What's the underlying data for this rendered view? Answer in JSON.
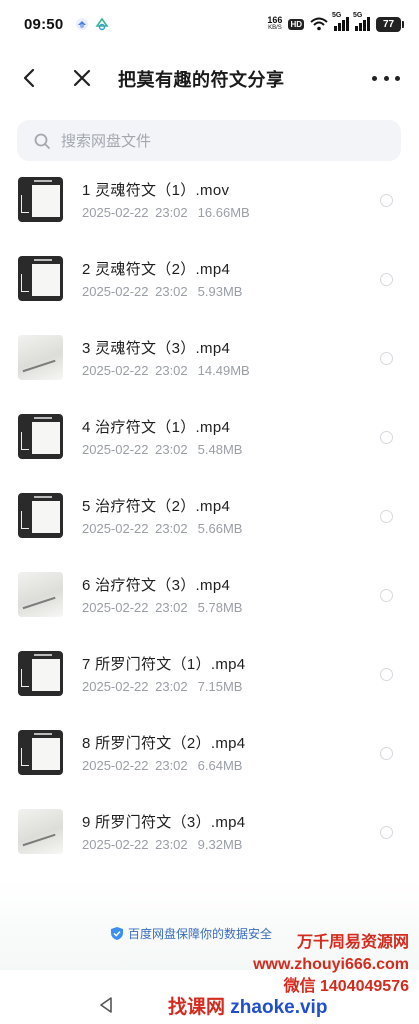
{
  "status_bar": {
    "time": "09:50",
    "net_speed_value": "166",
    "net_speed_unit": "KB/S",
    "hd_label": "HD",
    "signal_1_label": "5G",
    "signal_2_label": "5G",
    "battery": "77"
  },
  "header": {
    "title": "把莫有趣的符文分享",
    "back_icon": "back-arrow-icon",
    "close_icon": "close-icon",
    "more_icon": "more-icon"
  },
  "search": {
    "placeholder": "搜索网盘文件"
  },
  "files": [
    {
      "name": "1 灵魂符文（1）.mov",
      "date": "2025-02-22  23:02",
      "size": "16.66MB",
      "thumb": "dark"
    },
    {
      "name": "2 灵魂符文（2）.mp4",
      "date": "2025-02-22  23:02",
      "size": "5.93MB",
      "thumb": "dark"
    },
    {
      "name": "3 灵魂符文（3）.mp4",
      "date": "2025-02-22  23:02",
      "size": "14.49MB",
      "thumb": "light"
    },
    {
      "name": "4 治疗符文（1）.mp4",
      "date": "2025-02-22  23:02",
      "size": "5.48MB",
      "thumb": "dark"
    },
    {
      "name": "5 治疗符文（2）.mp4",
      "date": "2025-02-22  23:02",
      "size": "5.66MB",
      "thumb": "dark"
    },
    {
      "name": "6 治疗符文（3）.mp4",
      "date": "2025-02-22  23:02",
      "size": "5.78MB",
      "thumb": "light"
    },
    {
      "name": "7 所罗门符文（1）.mp4",
      "date": "2025-02-22  23:02",
      "size": "7.15MB",
      "thumb": "dark"
    },
    {
      "name": "8 所罗门符文（2）.mp4",
      "date": "2025-02-22  23:02",
      "size": "6.64MB",
      "thumb": "dark"
    },
    {
      "name": "9 所罗门符文（3）.mp4",
      "date": "2025-02-22  23:02",
      "size": "9.32MB",
      "thumb": "light"
    }
  ],
  "footer": {
    "note": "百度网盘保障你的数据安全"
  },
  "watermark": {
    "line1": "万千周易资源网",
    "line2": "www.zhouyi666.com",
    "line3": "微信 1404049576",
    "bottom_a": "找课网",
    "bottom_b": "zhaoke.vip"
  },
  "colors": {
    "accent_blue": "#3a6cc0",
    "watermark_red": "#d52b1e",
    "watermark_blue": "#1f4fd0",
    "muted_text": "#9a9ea6"
  }
}
